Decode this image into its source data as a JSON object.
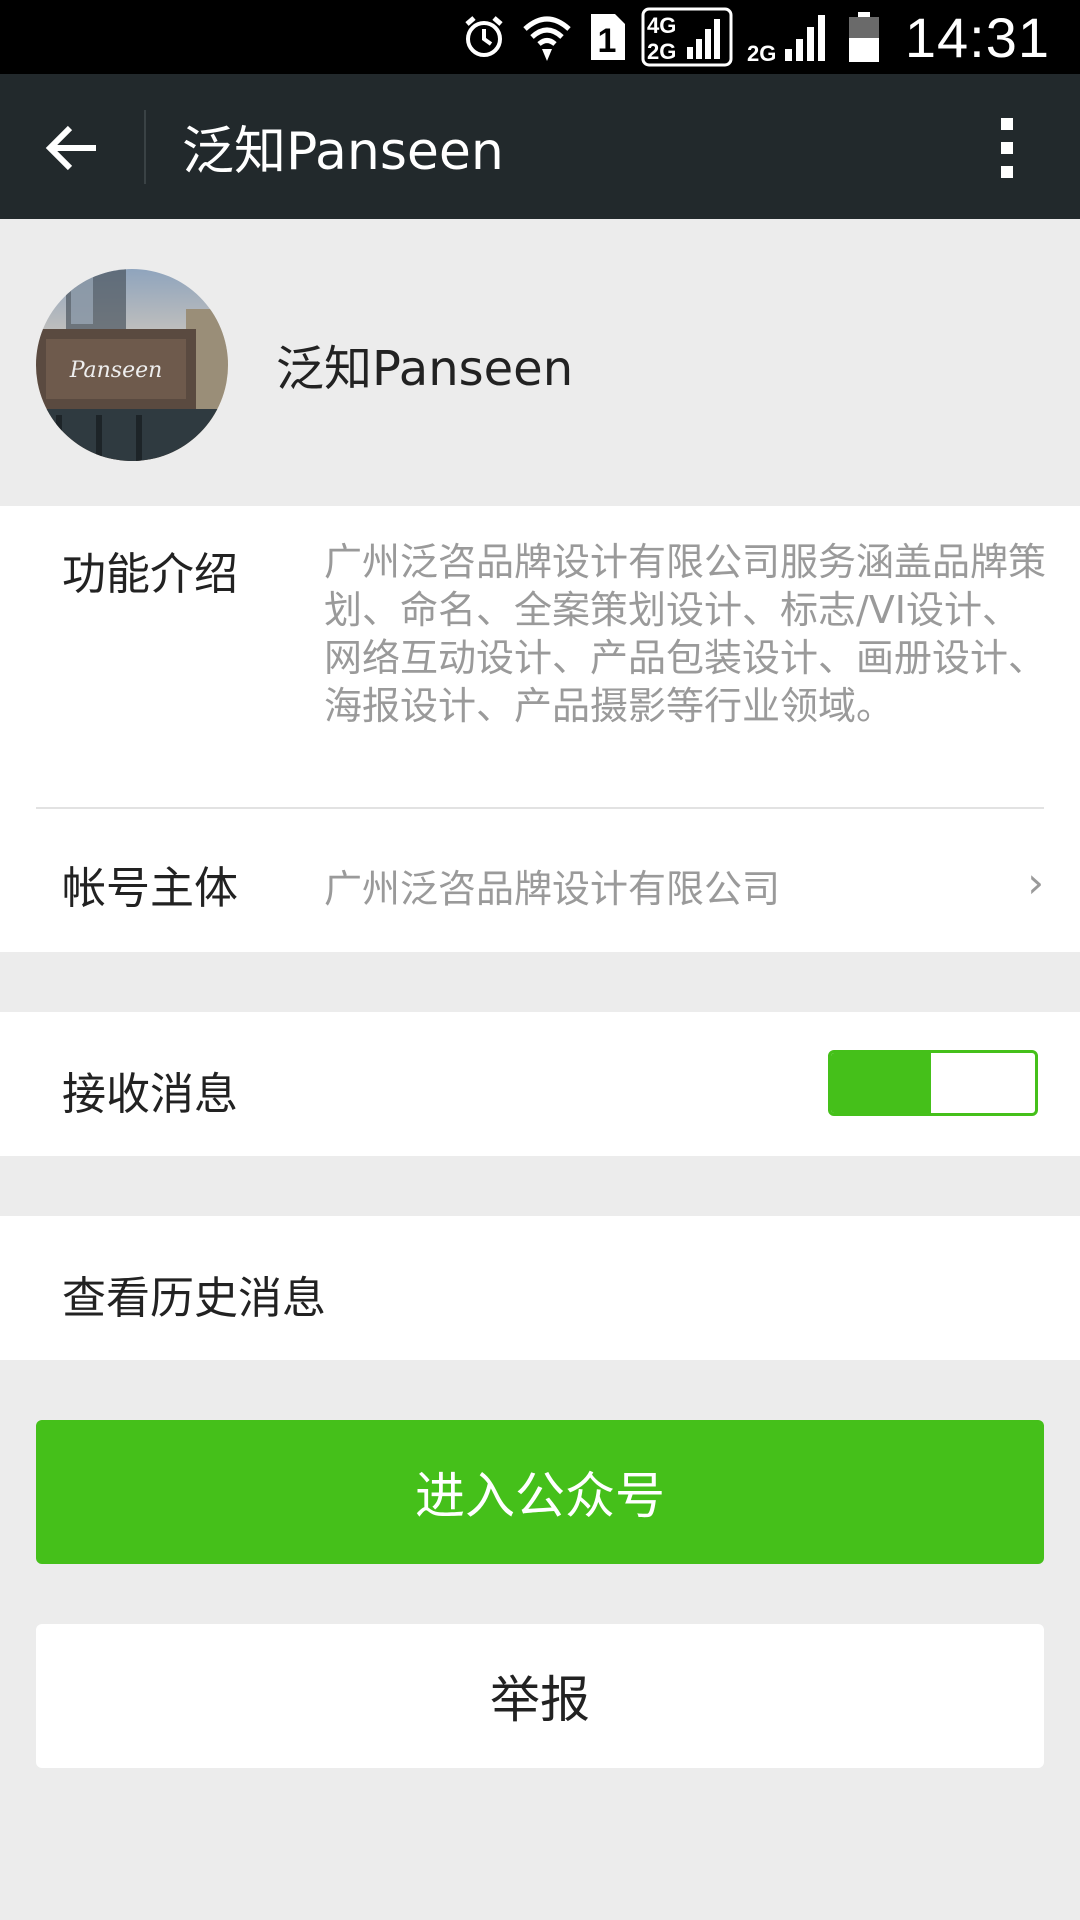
{
  "status_bar": {
    "time": "14:31",
    "sim_badge": "1",
    "network_4g": "4G",
    "network_2g_top": "2G",
    "network_2g": "2G",
    "icons": [
      "alarm-icon",
      "wifi-icon",
      "sim-icon",
      "signal-4g-2g-icon",
      "signal-2g-icon",
      "battery-icon"
    ]
  },
  "action_bar": {
    "title": "泛知Panseen",
    "back_icon": "back-arrow-icon",
    "more_icon": "more-vertical-icon"
  },
  "profile": {
    "name": "泛知Panseen",
    "avatar_text": "Panseen"
  },
  "info": {
    "intro_label": "功能介绍",
    "intro_text": "广州泛咨品牌设计有限公司服务涵盖品牌策划、命名、全案策划设计、标志/VI设计、网络互动设计、产品包装设计、画册设计、海报设计、产品摄影等行业领域。",
    "owner_label": "帐号主体",
    "owner_value": "广州泛咨品牌设计有限公司",
    "chevron": "›"
  },
  "receive": {
    "label": "接收消息",
    "enabled_fraction": 1
  },
  "history": {
    "label": "查看历史消息"
  },
  "buttons": {
    "enter": "进入公众号",
    "report": "举报"
  },
  "colors": {
    "accent": "#45c01a",
    "action_bar": "#22292c",
    "background": "#ececec"
  }
}
